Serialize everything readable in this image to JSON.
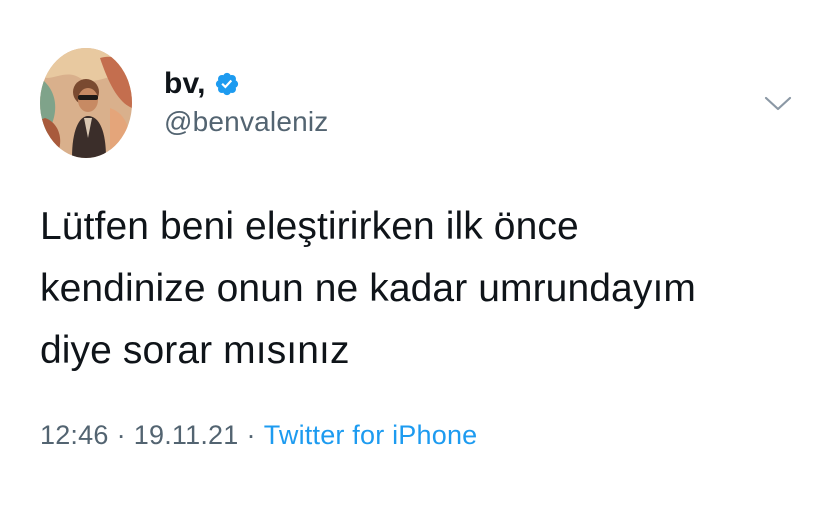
{
  "author": {
    "display_name": "bv,",
    "username": "@benvaleniz",
    "verified": true,
    "avatar_icon": "profile-photo"
  },
  "tweet": {
    "text_lines": [
      "Lütfen beni eleştirirken ilk önce",
      "kendinize onun ne kadar umrundayım",
      "diye sorar mısınız"
    ]
  },
  "meta": {
    "time": "12:46",
    "separator": "·",
    "date": "19.11.21",
    "source": "Twitter for iPhone"
  },
  "colors": {
    "verified_blue": "#1d9bf0",
    "secondary_text": "#536471",
    "primary_text": "#0f1419"
  },
  "icons": {
    "menu": "chevron-down-icon",
    "verified": "verified-badge-icon"
  }
}
